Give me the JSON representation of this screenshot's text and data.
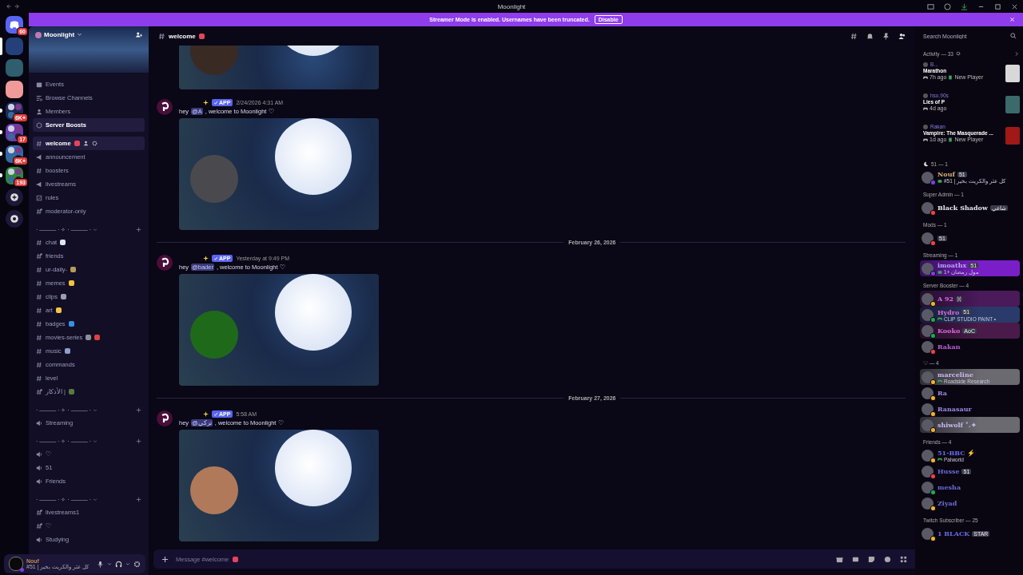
{
  "window": {
    "title": "Moonlight"
  },
  "banner": {
    "text": "Streamer Mode is enabled. Usernames have been truncated.",
    "button": "Disable"
  },
  "servers": [
    {
      "kind": "home",
      "color": "#5865f2",
      "badge": "60",
      "selected": false,
      "unread": false
    },
    {
      "kind": "server",
      "color": "#24407a",
      "selected": true,
      "unread": false
    },
    {
      "kind": "server",
      "color": "#2f5e6e",
      "selected": false,
      "unread": false
    },
    {
      "kind": "server",
      "color": "#f09a9a",
      "selected": false,
      "unread": false
    },
    {
      "kind": "folder",
      "color": "#1c2a5a",
      "badge": "6K+",
      "selected": false,
      "unread": true
    },
    {
      "kind": "folder",
      "color": "#6a3ab0",
      "badge": "17",
      "selected": false,
      "unread": true
    },
    {
      "kind": "folder",
      "color": "#2e6aa8",
      "badge": "6K+",
      "selected": false,
      "unread": true
    },
    {
      "kind": "folder",
      "color": "#2a8a3a",
      "badge": "193",
      "selected": false,
      "unread": true
    },
    {
      "kind": "add",
      "selected": false,
      "unread": false
    },
    {
      "kind": "discover",
      "selected": false,
      "unread": false
    }
  ],
  "server": {
    "name": "Moonlight"
  },
  "nav": [
    {
      "label": "Events",
      "kind": "events",
      "selected": false
    },
    {
      "label": "Browse Channels",
      "kind": "browse",
      "selected": false
    },
    {
      "label": "Members",
      "kind": "members",
      "selected": false
    },
    {
      "label": "Server Boosts",
      "kind": "boosts",
      "selected": true
    }
  ],
  "channels": [
    {
      "name": "welcome",
      "kind": "text",
      "selected": true,
      "emoji": [
        {
          "color": "#e8435a"
        }
      ]
    },
    {
      "name": "announcement",
      "kind": "announcement",
      "selected": false
    },
    {
      "name": "boosters",
      "kind": "text",
      "selected": false
    },
    {
      "name": "livestreams",
      "kind": "announcement",
      "selected": false
    },
    {
      "name": "rules",
      "kind": "rules",
      "selected": false
    },
    {
      "name": "moderator-only",
      "kind": "locked",
      "selected": false
    }
  ],
  "categories": [
    {
      "name": "· ——— · ✧ · ——— ·",
      "channels": [
        {
          "name": "chat",
          "kind": "text",
          "selected": false,
          "emoji": [
            {
              "color": "#dfe6f0"
            }
          ]
        },
        {
          "name": "friends",
          "kind": "locked",
          "selected": false
        },
        {
          "name": "ur-daily-",
          "kind": "text",
          "selected": false,
          "emoji": [
            {
              "color": "#b89a5a"
            }
          ]
        },
        {
          "name": "memes",
          "kind": "text",
          "selected": false,
          "emoji": [
            {
              "color": "#f2c33a"
            }
          ]
        },
        {
          "name": "clips",
          "kind": "text",
          "selected": false,
          "emoji": [
            {
              "color": "#9aa0b0"
            }
          ]
        },
        {
          "name": "art",
          "kind": "text",
          "selected": false,
          "emoji": [
            {
              "color": "#f5c542"
            }
          ]
        },
        {
          "name": "badges",
          "kind": "text",
          "selected": false,
          "emoji": [
            {
              "color": "#3a8ee6"
            }
          ]
        },
        {
          "name": "movies-series",
          "kind": "text",
          "selected": false,
          "emoji": [
            {
              "color": "#8a8f9a"
            },
            {
              "color": "#e04040"
            }
          ]
        },
        {
          "name": "music",
          "kind": "text",
          "selected": false,
          "emoji": [
            {
              "color": "#8fa0c8"
            }
          ]
        },
        {
          "name": "commands",
          "kind": "text",
          "selected": false
        },
        {
          "name": "level",
          "kind": "text",
          "selected": false
        },
        {
          "name": "الأذكار |",
          "kind": "locked",
          "selected": false,
          "emoji": [
            {
              "color": "#5a7a3a"
            }
          ]
        }
      ]
    },
    {
      "name": "· ——— · ✧ · ——— ·",
      "channels": [
        {
          "name": "Streaming",
          "kind": "voice",
          "selected": false
        }
      ]
    },
    {
      "name": "· ——— · ✧ · ——— ·",
      "channels": [
        {
          "name": "♡",
          "kind": "voice",
          "selected": false
        },
        {
          "name": "51",
          "kind": "voice",
          "selected": false
        },
        {
          "name": "Friends",
          "kind": "voice",
          "selected": false
        }
      ]
    },
    {
      "name": "· ——— · ✧ · ——— ·",
      "channels": [
        {
          "name": "livestreams1",
          "kind": "locked",
          "selected": false
        },
        {
          "name": "♡",
          "kind": "locked",
          "selected": false
        },
        {
          "name": "Studying",
          "kind": "voice",
          "selected": false
        }
      ]
    }
  ],
  "user_panel": {
    "name": "Nouf",
    "status": "#51 | كل عثر والكريت بخير"
  },
  "channel_header": {
    "name": "welcome",
    "emoji": [
      {
        "color": "#e8435a"
      }
    ]
  },
  "messages": [
    {
      "kind": "attachment"
    },
    {
      "kind": "message",
      "tag": "APP",
      "time": "2/24/2026 4:31 AM",
      "before": "hey",
      "mention": "@A",
      "after": ", welcome to Moonlight ♡"
    },
    {
      "kind": "divider",
      "date": "February 26, 2026"
    },
    {
      "kind": "message",
      "tag": "APP",
      "time": "Yesterday at 9:49 PM",
      "before": "hey",
      "mention": "@bader",
      "after": ", welcome to Moonlight ♡"
    },
    {
      "kind": "divider",
      "date": "February 27, 2026"
    },
    {
      "kind": "message",
      "tag": "APP",
      "time": "5:58 AM",
      "before": "hey",
      "mention": "@تركي",
      "after": ", welcome to Moonlight ♡"
    }
  ],
  "composer": {
    "placeholder": "Message #welcome",
    "emoji": [
      {
        "color": "#e8435a"
      }
    ]
  },
  "search": {
    "placeholder": "Search Moonlight"
  },
  "activity": {
    "title": "Activity — 33",
    "items": [
      {
        "user": "B...",
        "game": "Marathon",
        "time": "7h ago",
        "badge": "New Player"
      },
      {
        "user": "hso.90s",
        "game": "Lies of P",
        "time": "4d ago"
      },
      {
        "user": "Rakan",
        "game": "Vampire: The Masquerade ...",
        "time": "1d ago",
        "badge": "New Player"
      }
    ]
  },
  "member_groups": [
    {
      "title": "51 — 1",
      "members": [
        {
          "name": "Nouf",
          "color": "#d8b07a",
          "kind": "streaming",
          "tags": [
            "51"
          ],
          "activity": {
            "kind": "custom",
            "text": "#51 | كل عثر والكريت بخير"
          }
        }
      ]
    },
    {
      "title": "Super Admin — 1",
      "members": [
        {
          "name": "Black Shadow",
          "color": "#e6e6ee",
          "kind": "dnd",
          "tags": [
            "شاعي"
          ]
        }
      ]
    },
    {
      "title": "Mods — 1",
      "members": [
        {
          "kind": "dnd",
          "tags": [
            "51"
          ]
        }
      ]
    },
    {
      "title": "Streaming — 1",
      "members": [
        {
          "name": "imoathx",
          "color": "#b8a8f0",
          "kind": "streaming",
          "tags": [
            "51"
          ],
          "activity": {
            "kind": "custom",
            "text": "مول رمضان +1"
          },
          "nameplate": {
            "color": "#7a1ec8"
          }
        }
      ]
    },
    {
      "title": "Server Booster — 4",
      "members": [
        {
          "name": "A 92",
          "color": "#d86ad8",
          "kind": "idle",
          "tags": [
            "ᛞ"
          ],
          "nameplate": {
            "color": "#4a1a5a"
          }
        },
        {
          "name": "Hydro",
          "color": "#d86ad8",
          "kind": "online",
          "tags": [
            "51"
          ],
          "activity": {
            "kind": "game",
            "text": "CLIP STUDIO PAINT •"
          },
          "nameplate": {
            "color": "#2a3a6a"
          }
        },
        {
          "name": "Kooko",
          "color": "#d86ad8",
          "kind": "online",
          "tags": [
            "AoC"
          ],
          "nameplate": {
            "color": "#4a1a4a"
          }
        },
        {
          "name": "Rakan",
          "color": "#c05ad8",
          "kind": "dnd"
        }
      ]
    },
    {
      "title": "♡ — 4",
      "members": [
        {
          "name": "marceline",
          "color": "#c8b8f0",
          "kind": "idle",
          "activity": {
            "kind": "game",
            "text": "Roadside Research"
          },
          "nameplate": {
            "color": "#6a6a70"
          }
        },
        {
          "name": "Ra",
          "color": "#9a8ae8",
          "kind": "idle"
        },
        {
          "name": "Ranasaur",
          "color": "#9a8ae8",
          "kind": "idle"
        },
        {
          "name": "shiwolf ˚.✦",
          "color": "#c8b8f0",
          "kind": "idle",
          "nameplate": {
            "color": "#6a6a70"
          }
        }
      ]
    },
    {
      "title": "Friends — 4",
      "members": [
        {
          "name": "51-BBC ⚡",
          "color": "#6a6ae8",
          "kind": "idle",
          "activity": {
            "kind": "game",
            "text": "Palworld"
          }
        },
        {
          "name": "Husse",
          "color": "#6a6ad8",
          "kind": "dnd",
          "tags": [
            "51"
          ]
        },
        {
          "name": "mesha",
          "color": "#6a6ad8",
          "kind": "online"
        },
        {
          "name": "Ziyad",
          "color": "#6a6ad8",
          "kind": "idle"
        }
      ]
    },
    {
      "title": "Twitch Subscriber — 25",
      "members": [
        {
          "name": "1 BLACK",
          "color": "#6a6ae8",
          "kind": "idle",
          "tags": [
            "STAR"
          ]
        }
      ]
    }
  ]
}
